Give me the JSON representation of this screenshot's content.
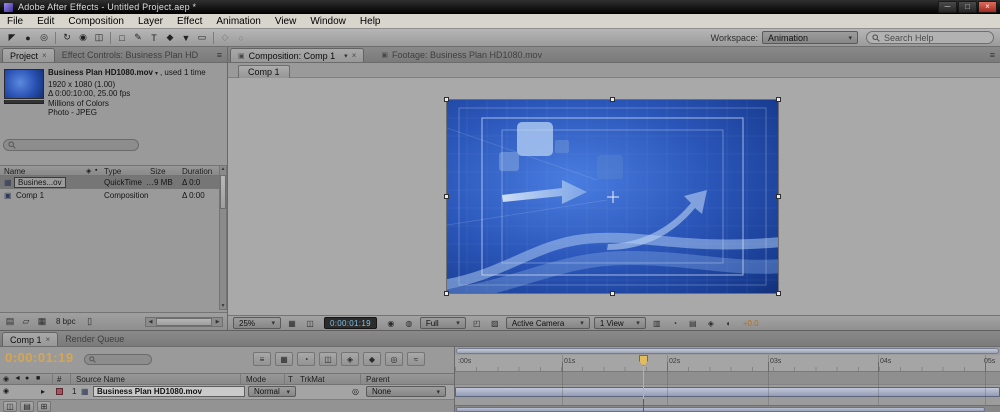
{
  "titlebar": {
    "title": "Adobe After Effects - Untitled Project.aep *"
  },
  "menubar": {
    "items": [
      "File",
      "Edit",
      "Composition",
      "Layer",
      "Effect",
      "Animation",
      "View",
      "Window",
      "Help"
    ]
  },
  "toolbar": {
    "tools": [
      {
        "glyph": "◤"
      },
      {
        "glyph": "●"
      },
      {
        "glyph": "◎"
      },
      {
        "glyph": "↻"
      },
      {
        "glyph": "◉"
      },
      {
        "glyph": "◫"
      },
      {
        "glyph": "□"
      },
      {
        "glyph": "✎"
      },
      {
        "glyph": "T"
      },
      {
        "glyph": "◆"
      },
      {
        "glyph": "▼"
      },
      {
        "glyph": "▭"
      },
      {
        "glyph": "◇"
      },
      {
        "glyph": "○"
      }
    ],
    "workspace_label": "Workspace:",
    "workspace_value": "Animation",
    "search_placeholder": "Search Help"
  },
  "project": {
    "tab_project": "Project",
    "tab_effect_controls": "Effect Controls: Business Plan HD",
    "info": {
      "filename": "Business Plan HD1080.mov",
      "usage": ", used 1 time",
      "resolution": "1920 x 1080 (1.00)",
      "duration": "Δ 0:00:10:00, 25.00 fps",
      "colors": "Millions of Colors",
      "codec": "Photo - JPEG"
    },
    "columns": {
      "name": "Name",
      "type": "Type",
      "size": "Size",
      "duration": "Duration"
    },
    "rows": [
      {
        "name": "Busines...ov",
        "type": "QuickTime",
        "size": "…9 MB",
        "duration": "Δ 0:0"
      },
      {
        "name": "Comp 1",
        "type": "Composition",
        "size": "",
        "duration": "Δ 0:00"
      }
    ],
    "footer": {
      "bpc": "8 bpc"
    }
  },
  "comp": {
    "tab_composition": "Composition: Comp 1",
    "tab_footage": "Footage: Business Plan HD1080.mov",
    "comp_chip": "Comp 1",
    "controls": {
      "zoom": "25%",
      "timecode": "0:00:01:19",
      "resolution": "Full",
      "camera": "Active Camera",
      "view": "1 View",
      "exposure": "+0.0"
    }
  },
  "timeline": {
    "tab_comp": "Comp 1",
    "tab_render_queue": "Render Queue",
    "timecode": "0:00:01:19",
    "opts": [
      "≡",
      "▦",
      "◔",
      "◫",
      "◈",
      "◆",
      "◎",
      "≈"
    ],
    "columns": {
      "source_name": "Source Name",
      "mode": "Mode",
      "t": "T",
      "trkmat": "TrkMat",
      "parent": "Parent"
    },
    "layer": {
      "index": "1",
      "name": "Business Plan HD1080.mov",
      "mode": "Normal",
      "parent": "None"
    },
    "ruler": [
      ":00s",
      "01s",
      "02s",
      "03s",
      "04s",
      "05s"
    ]
  },
  "icons": {
    "dropdown_arrow": "▾",
    "close": "×",
    "minimize": "─",
    "maximize": "□",
    "panel_menu": "≡",
    "panel_tab": "▣",
    "eye": "◉",
    "audio": "◄",
    "solo": "●",
    "lock": "■",
    "index_col": "#",
    "label_col": "◈",
    "flag_col": "▪",
    "expand": "▸",
    "pick_whip": "◎",
    "film": "▦",
    "composition_item": "▣",
    "interpret": "▤",
    "new_folder": "▱",
    "new_comp": "▦",
    "trash": "▯",
    "up": "▲",
    "down": "▼",
    "left": "◀",
    "right": "▶",
    "grid": "▦",
    "safe_guides": "◫",
    "camera_snapshot": "◉",
    "show_snapshot": "◍",
    "roi": "◰",
    "checker": "▨",
    "pixel_aspect": "▥",
    "fast_preview": "◔",
    "mini_flow": "◈",
    "reset_exposure": "◐",
    "switches": "◫",
    "modes": "▤",
    "inout": "⊞"
  },
  "palette": {
    "timecode_gold": "#d8a64f",
    "comp_timecode_blue": "#7fc0e8",
    "close_button_red": "#b8372e",
    "layer_bar_blue": "#9aa3bd",
    "footage_blue": "#2a52b4"
  }
}
